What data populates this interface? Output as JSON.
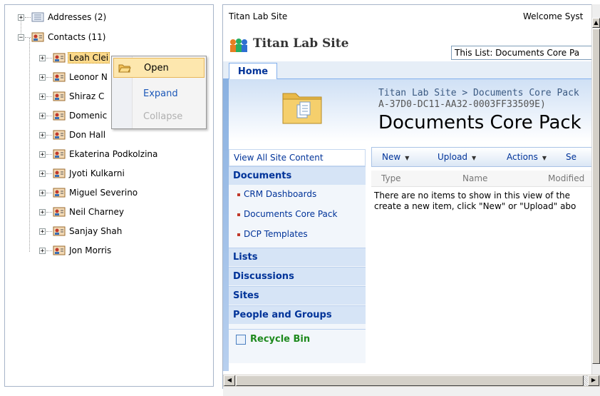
{
  "tree": {
    "nodes": [
      {
        "label": "Addresses (2)",
        "expander": "+",
        "icon": "address-book-icon"
      },
      {
        "label": "Contacts (11)",
        "expander": "−",
        "icon": "contact-card-icon"
      },
      {
        "label": "Leah Clei",
        "expander": "+",
        "icon": "contact-card-icon"
      },
      {
        "label": "Leonor N",
        "expander": "+",
        "icon": "contact-card-icon"
      },
      {
        "label": "Shiraz C",
        "expander": "+",
        "icon": "contact-card-icon"
      },
      {
        "label": "Domenic",
        "expander": "+",
        "icon": "contact-card-icon"
      },
      {
        "label": "Don Hall",
        "expander": "+",
        "icon": "contact-card-icon"
      },
      {
        "label": "Ekaterina Podkolzina",
        "expander": "+",
        "icon": "contact-card-icon"
      },
      {
        "label": "Jyoti Kulkarni",
        "expander": "+",
        "icon": "contact-card-icon"
      },
      {
        "label": "Miguel Severino",
        "expander": "+",
        "icon": "contact-card-icon"
      },
      {
        "label": "Neil Charney",
        "expander": "+",
        "icon": "contact-card-icon"
      },
      {
        "label": "Sanjay Shah",
        "expander": "+",
        "icon": "contact-card-icon"
      },
      {
        "label": "Jon Morris",
        "expander": "+",
        "icon": "contact-card-icon"
      }
    ]
  },
  "context_menu": {
    "items": [
      {
        "label": "Open",
        "state": "hover",
        "icon": "folder-open-icon"
      },
      {
        "label": "Expand",
        "state": "enabled"
      },
      {
        "label": "Collapse",
        "state": "disabled"
      }
    ]
  },
  "sharepoint": {
    "top_site_link": "Titan Lab Site",
    "welcome_text": "Welcome Syst",
    "site_title": "Titan Lab Site",
    "search_scope": "This List: Documents Core Pa",
    "tab_home": "Home",
    "breadcrumb": "Titan Lab Site > Documents Core Pack",
    "guid_fragment": "A-37D0-DC11-AA32-0003FF33509E)",
    "page_title": "Documents Core Pack",
    "quick_launch": {
      "view_all": "View All Site Content",
      "documents_heading": "Documents",
      "documents_items": [
        "CRM Dashboards",
        "Documents Core Pack",
        "DCP Templates"
      ],
      "lists": "Lists",
      "discussions": "Discussions",
      "sites": "Sites",
      "people_groups": "People and Groups",
      "recycle_bin": "Recycle Bin"
    },
    "toolbar": {
      "new": "New",
      "upload": "Upload",
      "actions": "Actions",
      "settings_partial": "Se"
    },
    "list_columns": [
      "Type",
      "Name",
      "Modified"
    ],
    "empty_message_line1": "There are no items to show in this view of the",
    "empty_message_line2": "create a new item, click \"New\" or \"Upload\" abo"
  },
  "colors": {
    "accent_link": "#003399",
    "selection": "#fcd98a",
    "recycle_green": "#1e8a1e"
  }
}
